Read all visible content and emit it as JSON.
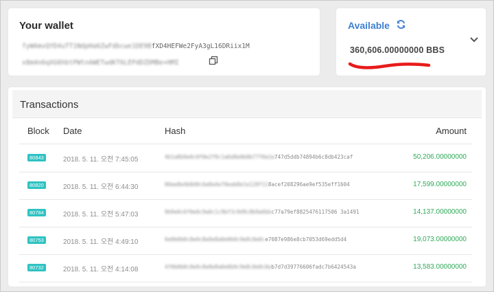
{
  "wallet": {
    "title": "Your wallet",
    "address_line1_masked": "fyWAmvQYD4uTT1NdpHa6ZwFdbcwe1DE9B",
    "address_line1": "fXD4HEFWe2FyA3gL16DRiix1M",
    "address_line2_masked": "x8m4n6qXG6hbtPWtnAWETwdKT6LEPdDZDMBe+HMI"
  },
  "balance": {
    "label": "Available",
    "amount": "360,606.00000000 BBS",
    "annotation_color": "#e81b1b"
  },
  "transactions": {
    "title": "Transactions",
    "columns": {
      "block": "Block",
      "date": "Date",
      "hash": "Hash",
      "amount": "Amount"
    },
    "rows": [
      {
        "block": "80843",
        "date": "2018. 5. 11. 오전 7:45:05",
        "hash_masked": "4b1a8b9e0c0f0e2f9c1a6d8e0b0b77f0a1e",
        "hash": "747d5ddb74894b6c8db423caf",
        "amount": "50,206.00000000"
      },
      {
        "block": "80820",
        "date": "2018. 5. 11. 오전 6:44:30",
        "hash_masked": "00ae8e4b8d0c6a8a4e70eab8e1e128f11",
        "hash": "8acef208296ae9ef535eff1604",
        "amount": "17,599.00000000"
      },
      {
        "block": "80784",
        "date": "2018. 5. 11. 오전 5:47:03",
        "hash_masked": "9b9e0c6f0e0c9a0c1c9bf3c9d9c8b9a6bb",
        "hash": "c77a79ef8825476117506 3a1491",
        "amount": "14,137.00000000"
      },
      {
        "block": "80753",
        "date": "2018. 5. 11. 오전 4:49:10",
        "hash_masked": "6e0b0b0c0e0c8e8e8a0e0b0c9e8c0e0c",
        "hash": "e7087e986e8cb7053d69edd5d4",
        "amount": "19,073.00000000"
      },
      {
        "block": "80732",
        "date": "2018. 5. 11. 오전 4:14:08",
        "hash_masked": "4f0b0b0c0e0c8e8e8a0e0b0c9e8c0e0c0a",
        "hash": "b7d7d39776606fadc7b6424543a",
        "amount": "13,583.00000000"
      }
    ]
  },
  "icons": {
    "copy": "copy-icon",
    "refresh": "refresh-icon",
    "expand": "chevron-down-icon"
  },
  "colors": {
    "accent": "#3d7fd0",
    "badge": "#2fc2c2",
    "amount": "#2eaa57"
  }
}
